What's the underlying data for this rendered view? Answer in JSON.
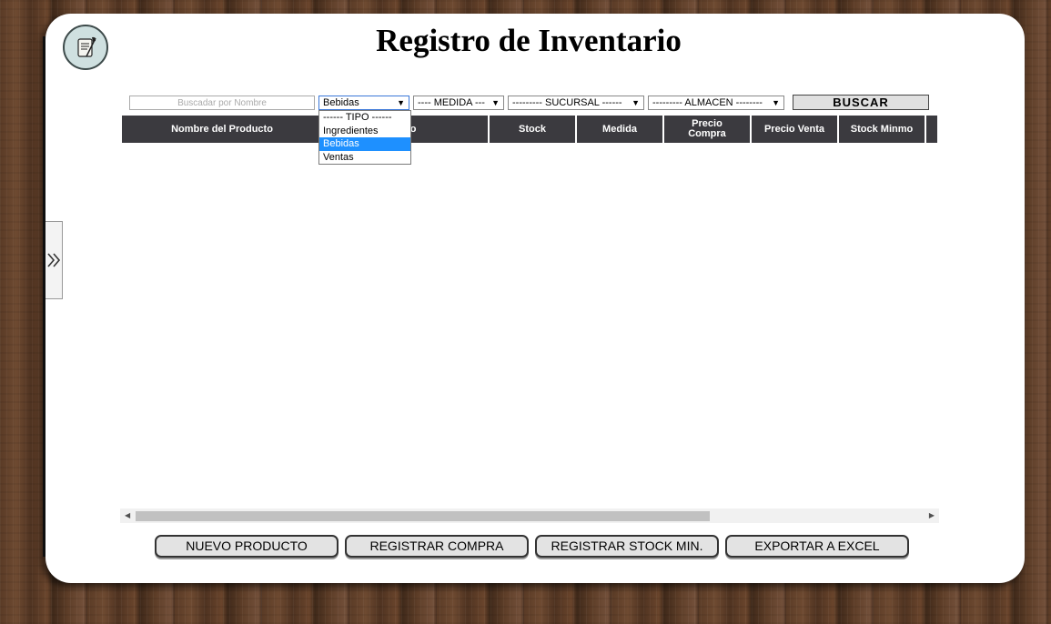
{
  "title": "Registro de Inventario",
  "filters": {
    "search_placeholder": "Buscadar por Nombre",
    "tipo_selected": "Bebidas",
    "medida_selected": "---- MEDIDA ---",
    "sucursal_selected": "--------- SUCURSAL ------",
    "almacen_selected": "--------- ALMACEN --------",
    "search_button": "BUSCAR",
    "tipo_options": [
      "------ TIPO ------",
      "Ingredientes",
      "Bebidas",
      "Ventas"
    ],
    "tipo_highlighted_index": 2
  },
  "table": {
    "columns": [
      "Nombre del Producto",
      "Tipo",
      "Stock",
      "Medida",
      "Precio Compra",
      "Precio Venta",
      "Stock Minmo",
      ""
    ],
    "rows": []
  },
  "buttons": {
    "nuevo_producto": "NUEVO PRODUCTO",
    "registrar_compra": "REGISTRAR COMPRA",
    "registrar_stock_min": "REGISTRAR STOCK MIN.",
    "exportar_excel": "EXPORTAR A EXCEL"
  },
  "icons": {
    "logo": "scroll-quill-icon",
    "side_toggle": "double-chevron-right-icon"
  },
  "colors": {
    "header_bg": "#3b3a3f",
    "selected_option": "#1e90ff",
    "button_bg": "#e3e3e3"
  }
}
